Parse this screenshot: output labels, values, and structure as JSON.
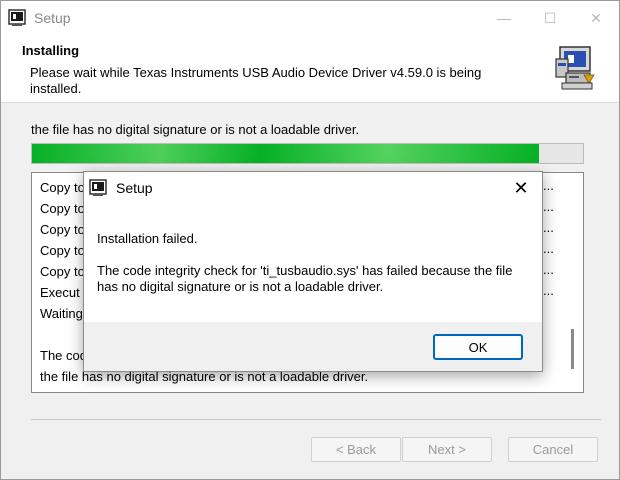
{
  "window": {
    "title": "Setup",
    "minimize_glyph": "—",
    "maximize_glyph": "☐",
    "close_glyph": "✕"
  },
  "header": {
    "title": "Installing",
    "description": "Please wait while Texas Instruments USB Audio Device Driver v4.59.0 is being installed.",
    "icon": "installer-computer-icon"
  },
  "status": {
    "text": "the file has no digital signature or is not a loadable driver.",
    "progress_fraction": 0.92
  },
  "log": {
    "lines": [
      "Copy to",
      "Copy to",
      "Copy to",
      "Copy to",
      "Copy to",
      "Execut",
      "Waiting",
      "",
      "The cod",
      "the file has no digital signature or is not a loadable driver."
    ],
    "ellipsis": "..."
  },
  "buttons": {
    "back": "< Back",
    "next": "Next >",
    "cancel": "Cancel"
  },
  "dialog": {
    "title": "Setup",
    "close_glyph": "✕",
    "message_title": "Installation failed.",
    "message_body": "The code integrity check for 'ti_tusbaudio.sys' has failed because the file has no digital signature or is not a loadable driver.",
    "ok_label": "OK"
  },
  "colors": {
    "progress_fill": "#06b025",
    "ok_border": "#0067c0"
  }
}
